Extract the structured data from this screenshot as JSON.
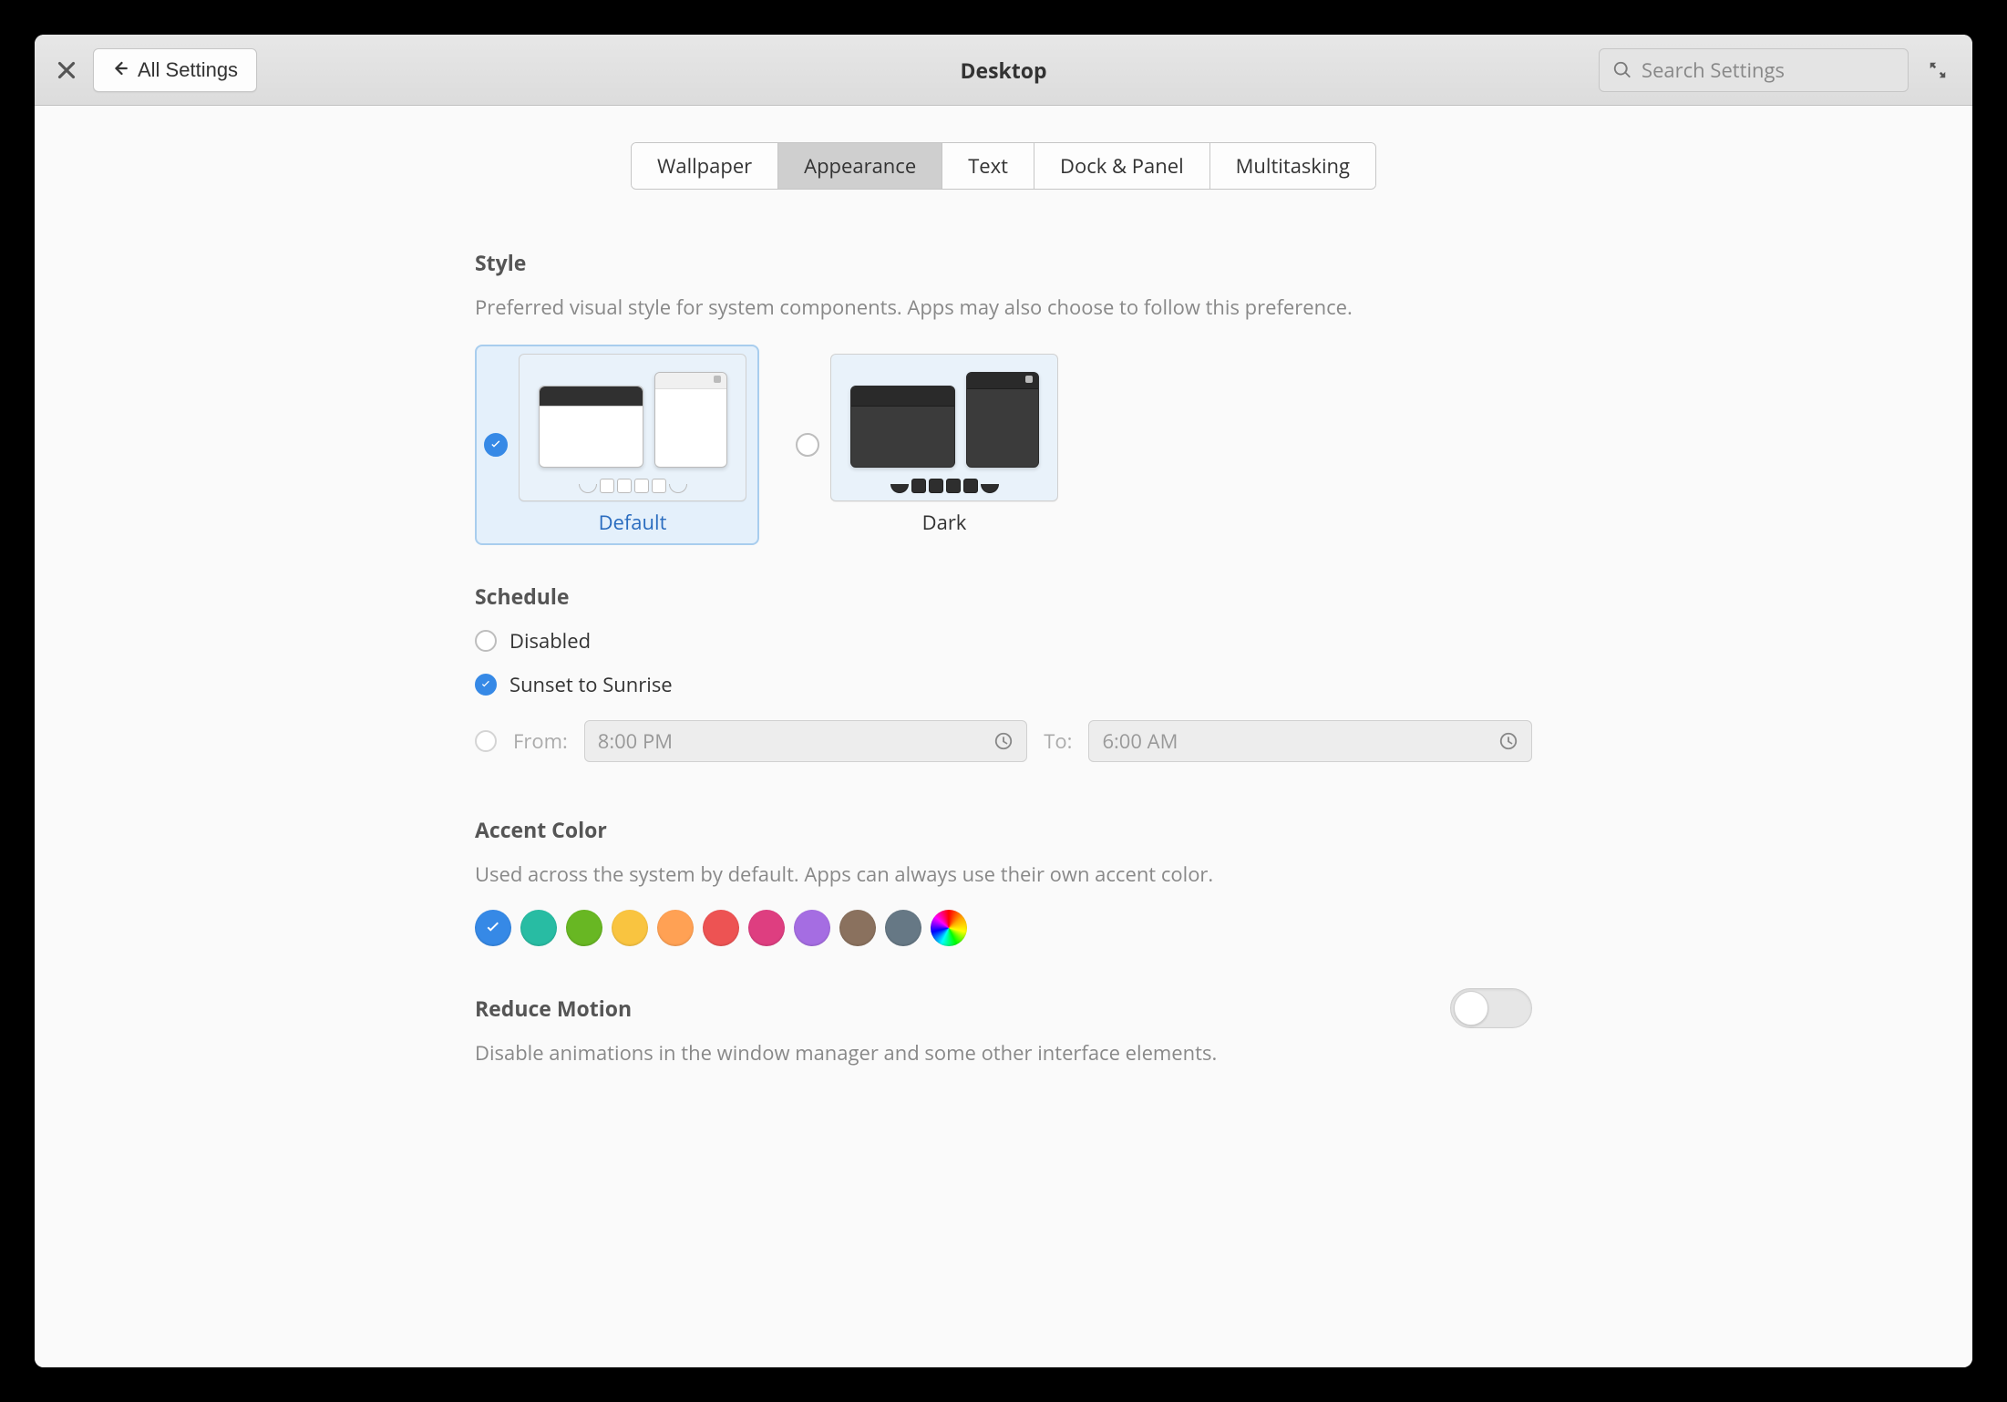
{
  "header": {
    "back_label": "All Settings",
    "title": "Desktop",
    "search_placeholder": "Search Settings"
  },
  "tabs": {
    "wallpaper": "Wallpaper",
    "appearance": "Appearance",
    "text": "Text",
    "dock_panel": "Dock & Panel",
    "multitasking": "Multitasking",
    "active": "appearance"
  },
  "style": {
    "title": "Style",
    "desc": "Preferred visual style for system components. Apps may also choose to follow this preference.",
    "default_label": "Default",
    "dark_label": "Dark",
    "selected": "default"
  },
  "schedule": {
    "title": "Schedule",
    "disabled_label": "Disabled",
    "sunset_label": "Sunset to Sunrise",
    "from_label": "From:",
    "to_label": "To:",
    "from_value": "8:00 PM",
    "to_value": "6:00 AM",
    "selected": "sunset"
  },
  "accent": {
    "title": "Accent Color",
    "desc": "Used across the system by default. Apps can always use their own accent color.",
    "colors": [
      "#3689e6",
      "#28bca3",
      "#68b723",
      "#f9c440",
      "#ffa154",
      "#ed5353",
      "#de3e80",
      "#a56de2",
      "#8a715e",
      "#667885",
      "rainbow"
    ],
    "selected_index": 0
  },
  "motion": {
    "title": "Reduce Motion",
    "desc": "Disable animations in the window manager and some other interface elements.",
    "enabled": false
  }
}
